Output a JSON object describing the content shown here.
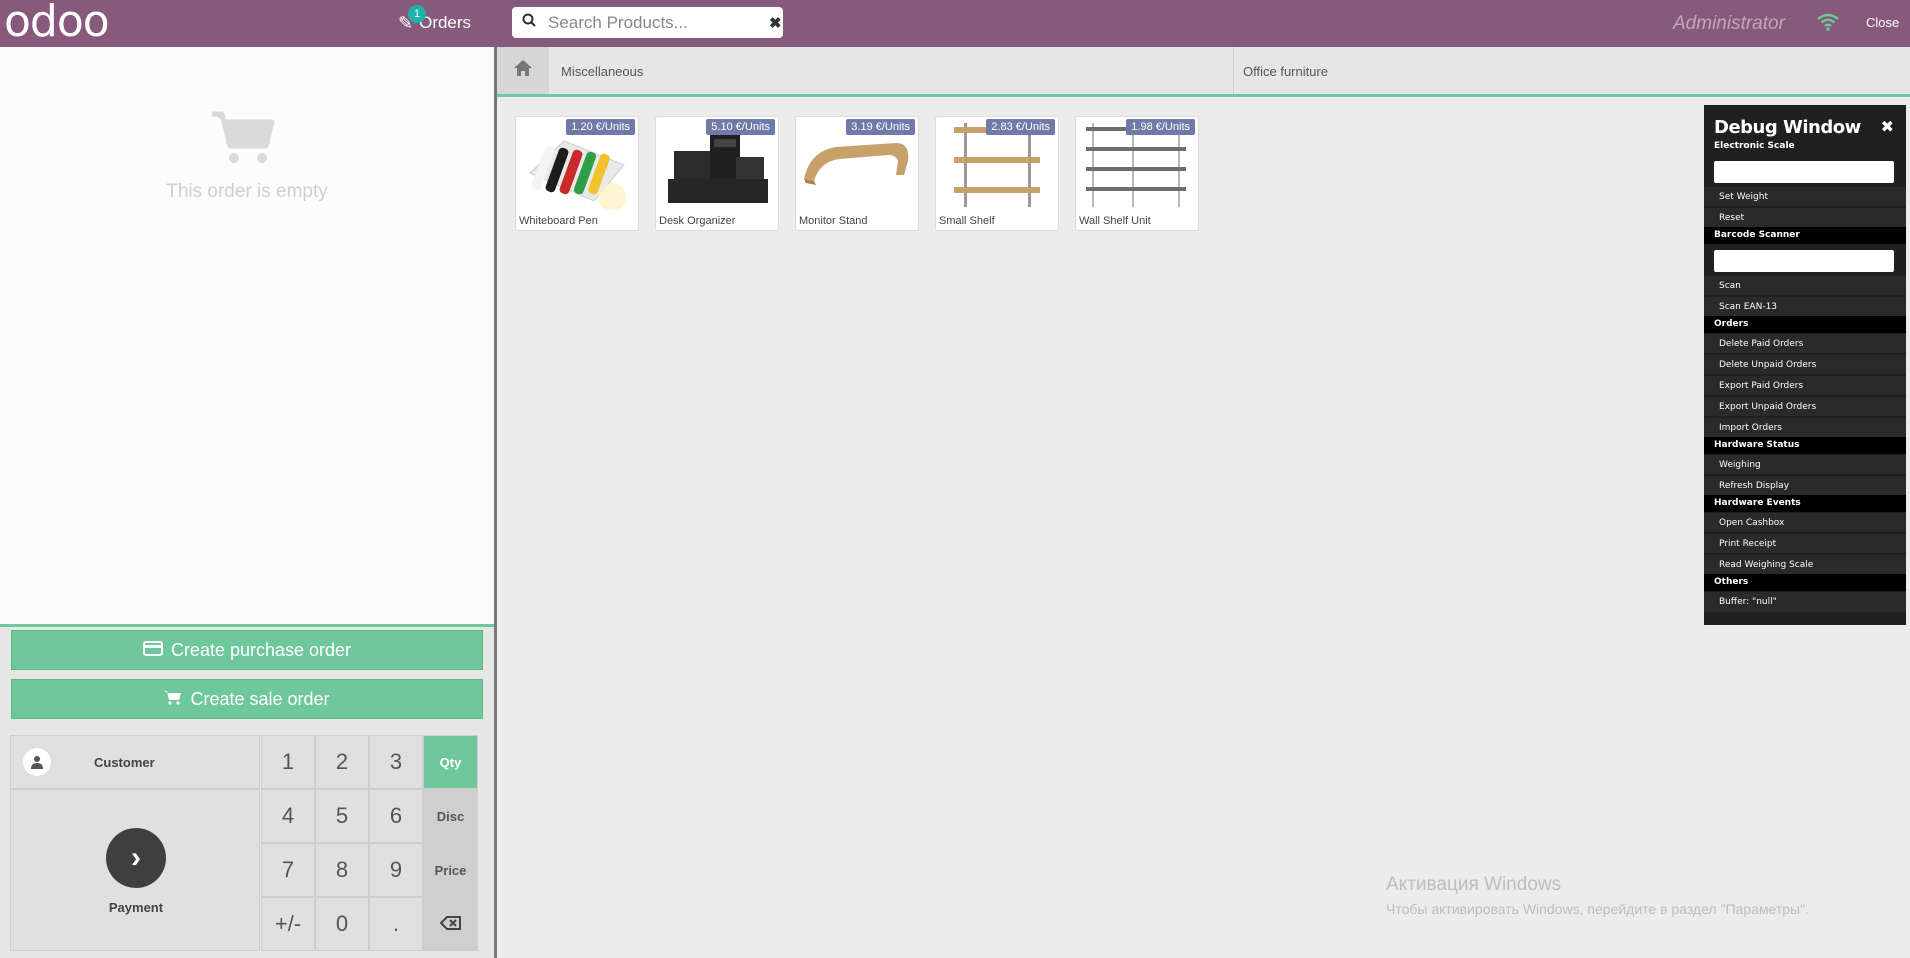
{
  "header": {
    "logo": "odoo",
    "orders_label": "Orders",
    "orders_count": "1",
    "search_placeholder": "Search Products...",
    "user": "Administrator",
    "close_label": "Close"
  },
  "order": {
    "empty_text": "This order is empty"
  },
  "actions": {
    "purchase": "Create purchase order",
    "sale": "Create sale order"
  },
  "pads": {
    "customer": "Customer",
    "payment": "Payment",
    "keys": [
      "1",
      "2",
      "3",
      "4",
      "5",
      "6",
      "7",
      "8",
      "9",
      "+/-",
      "0",
      "."
    ],
    "modes": [
      "Qty",
      "Disc",
      "Price"
    ],
    "active_mode": "Qty"
  },
  "categories": {
    "items": [
      "Miscellaneous",
      "Office furniture"
    ]
  },
  "products": [
    {
      "name": "Whiteboard Pen",
      "price": "1.20 €/Units"
    },
    {
      "name": "Desk Organizer",
      "price": "5.10 €/Units"
    },
    {
      "name": "Monitor Stand",
      "price": "3.19 €/Units"
    },
    {
      "name": "Small Shelf",
      "price": "2.83 €/Units"
    },
    {
      "name": "Wall Shelf Unit",
      "price": "1.98 €/Units"
    }
  ],
  "debug": {
    "title": "Debug Window",
    "sections": {
      "scale": "Electronic Scale",
      "barcode": "Barcode Scanner",
      "orders": "Orders",
      "hw_status": "Hardware Status",
      "hw_events": "Hardware Events",
      "others": "Others"
    },
    "items": {
      "set_weight": "Set Weight",
      "reset": "Reset",
      "scan": "Scan",
      "scan_ean": "Scan EAN-13",
      "delete_paid": "Delete Paid Orders",
      "delete_unpaid": "Delete Unpaid Orders",
      "export_paid": "Export Paid Orders",
      "export_unpaid": "Export Unpaid Orders",
      "import": "Import Orders",
      "weighing": "Weighing",
      "refresh": "Refresh Display",
      "open_cashbox": "Open Cashbox",
      "print_receipt": "Print Receipt",
      "read_scale": "Read Weighing Scale",
      "buffer": "Buffer: \"null\""
    }
  },
  "watermark": {
    "title": "Активация Windows",
    "subtitle": "Чтобы активировать Windows, перейдите в раздел \"Параметры\"."
  },
  "colors": {
    "header": "#875a7b",
    "accent": "#6ec89b",
    "price_badge": "#7179a8",
    "debug_bg": "#202020"
  }
}
